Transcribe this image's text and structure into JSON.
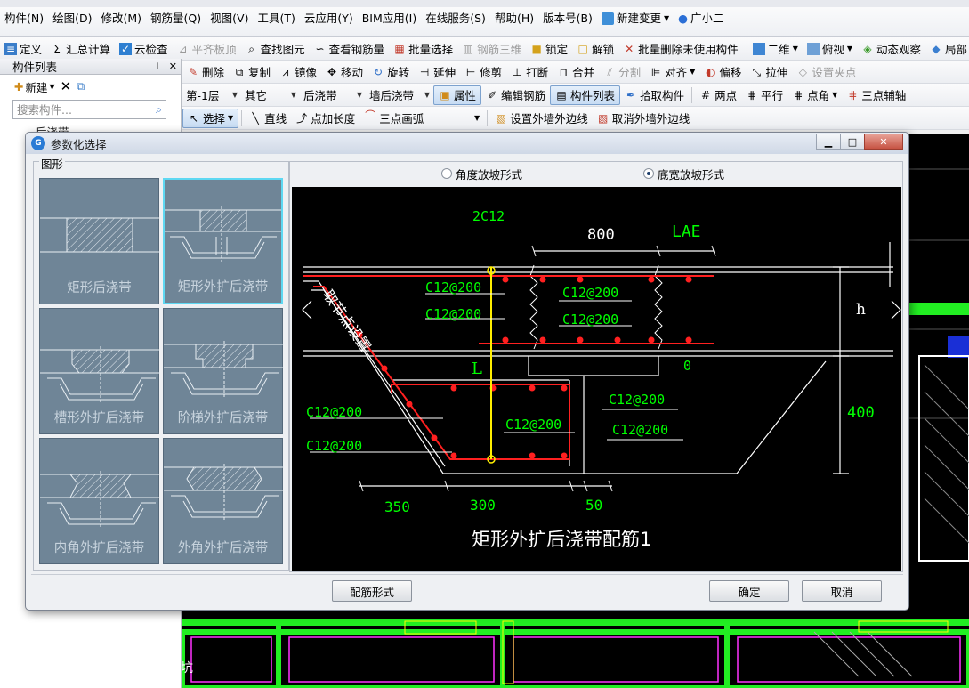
{
  "menu": {
    "items": [
      "构件(N)",
      "绘图(D)",
      "修改(M)",
      "钢筋量(Q)",
      "视图(V)",
      "工具(T)",
      "云应用(Y)",
      "BIM应用(I)",
      "在线服务(S)",
      "帮助(H)",
      "版本号(B)"
    ],
    "new_change": "新建变更",
    "assistant": "广小二"
  },
  "toolbar1": [
    "定义",
    "汇总计算",
    "云检查",
    "平齐板顶",
    "查找图元",
    "查看钢筋量",
    "批量选择",
    "钢筋三维",
    "锁定",
    "解锁",
    "批量删除未使用构件",
    "二维",
    "俯视",
    "动态观察",
    "局部"
  ],
  "toolbar2": [
    "删除",
    "复制",
    "镜像",
    "移动",
    "旋转",
    "延伸",
    "修剪",
    "打断",
    "合并",
    "分割",
    "对齐",
    "偏移",
    "拉伸",
    "设置夹点"
  ],
  "toolbar3": {
    "floor": "第-1层",
    "category": "其它",
    "type": "后浇带",
    "component": "墙后浇带",
    "buttons": [
      "属性",
      "编辑钢筋",
      "构件列表",
      "拾取构件"
    ],
    "right": [
      "两点",
      "平行",
      "点角",
      "三点辅轴"
    ]
  },
  "toolbar4": [
    "选择",
    "直线",
    "点加长度",
    "三点画弧",
    "设置外墙外边线",
    "取消外墙外边线"
  ],
  "left_panel": {
    "title": "构件列表",
    "new_label": "新建",
    "search_placeholder": "搜索构件...",
    "tree_item": "后浇带"
  },
  "dialog": {
    "title": "参数化选择",
    "group_label": "图形",
    "shapes": [
      {
        "label": "矩形后浇带",
        "selected": false
      },
      {
        "label": "矩形外扩后浇带",
        "selected": true
      },
      {
        "label": "槽形外扩后浇带",
        "selected": false
      },
      {
        "label": "阶梯外扩后浇带",
        "selected": false
      },
      {
        "label": "内角外扩后浇带",
        "selected": false
      },
      {
        "label": "外角外扩后浇带",
        "selected": false
      }
    ],
    "radio_angle": "角度放坡形式",
    "radio_width": "底宽放坡形式",
    "radio_selected": "底宽放坡形式",
    "buttons": {
      "rebar_form": "配筋形式",
      "ok": "确定",
      "cancel": "取消"
    }
  },
  "preview": {
    "title": "矩形外扩后浇带配筋1",
    "top_bar": "2C12",
    "dim_800": "800",
    "lae": "LAE",
    "h": "h",
    "zero": "0",
    "dim_400": "400",
    "l": "L",
    "dim_350": "350",
    "dim_300": "300",
    "dim_50": "50",
    "slope_note": "取节点设置",
    "rebar_labels": [
      "C12@200",
      "C12@200",
      "C12@200",
      "C12@200",
      "C12@200",
      "C12@200",
      "C12@200",
      "C12@200",
      "C12@200",
      "C12@200"
    ]
  },
  "canvas_label": "集水坑",
  "colors": {
    "dim_text": "#00ff00",
    "rebar": "#ff2020",
    "lines": "#ffffff",
    "yellow": "#ffee00",
    "card": "#6f8597"
  }
}
